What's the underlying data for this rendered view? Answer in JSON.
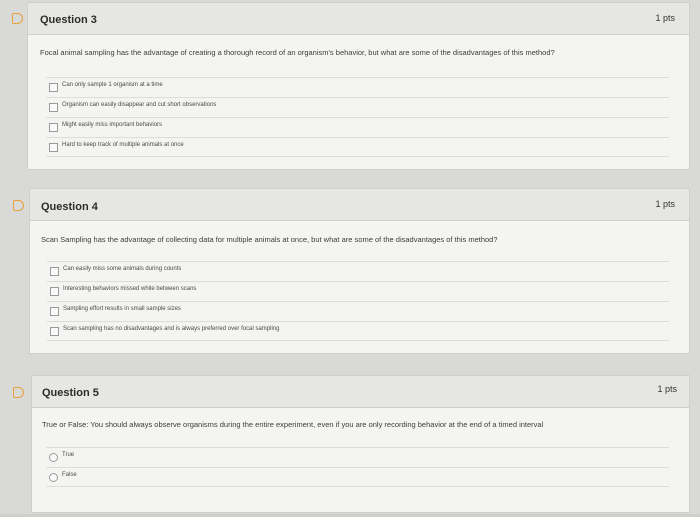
{
  "questions": [
    {
      "title": "Question 3",
      "points": "1 pts",
      "prompt": "Focal animal sampling has the advantage of creating a thorough record of an organism's behavior, but what are some of the disadvantages of this method?",
      "type": "checkbox",
      "options": [
        "Can only sample 1 organism at a time",
        "Organism can easily disappear and cut short observations",
        "Might easily miss important behaviors",
        "Hard to keep track of multiple animals at once"
      ]
    },
    {
      "title": "Question 4",
      "points": "1 pts",
      "prompt": "Scan Sampling has the advantage of collecting data for multiple animals at once, but what are some of the disadvantages of this method?",
      "type": "checkbox",
      "options": [
        "Can easily miss some animals during counts",
        "Interesting behaviors missed while between scans",
        "Sampling effort results in small sample sizes",
        "Scan sampling has no disadvantages and is always preferred over focal sampling"
      ]
    },
    {
      "title": "Question 5",
      "points": "1 pts",
      "prompt": "True or False: You should always observe organisms during the entire experiment, even if you are only recording behavior at the end of a timed interval",
      "type": "radio",
      "options": [
        "True",
        "False"
      ]
    }
  ],
  "colors": {
    "flag": "#e8a13a",
    "background": "#d9d9d7",
    "card": "#f4f4f2",
    "card_header": "#e6e6e3"
  },
  "icons": {
    "question_flag": "bookmark-flag-icon"
  }
}
